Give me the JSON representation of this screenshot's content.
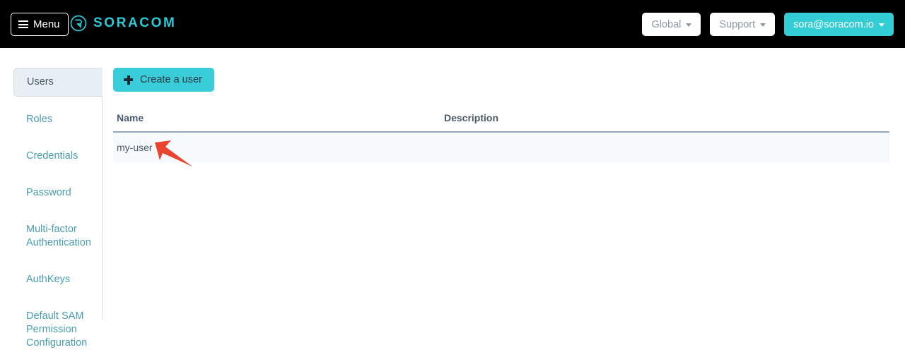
{
  "navbar": {
    "menu_label": "Menu",
    "menu_icon": "hamburger-icon",
    "brand_name": "SORACOM",
    "brand_icon": "soracom-logo-icon",
    "coverage_label": "Global",
    "support_label": "Support",
    "account_label": "sora@soracom.io",
    "caret_icon": "chevron-down-icon",
    "background_color": "#000000",
    "accent_color": "#33cdd6"
  },
  "sidebar": {
    "items": [
      {
        "label": "Users",
        "active": true
      },
      {
        "label": "Roles",
        "active": false
      },
      {
        "label": "Credentials",
        "active": false
      },
      {
        "label": "Password",
        "active": false
      },
      {
        "label": "Multi-factor Authentication",
        "active": false
      },
      {
        "label": "AuthKeys",
        "active": false
      },
      {
        "label": "Default SAM Permission Configuration",
        "active": false
      }
    ],
    "link_color": "#4a9cb0",
    "active_background": "#e7eff5"
  },
  "main": {
    "create_button_label": "Create a user",
    "create_button_icon": "plus-icon",
    "create_button_color": "#38cdd8",
    "table": {
      "columns": [
        "Name",
        "Description"
      ],
      "rows": [
        {
          "name": "my-user",
          "description": ""
        }
      ],
      "header_border_color": "#95a9bd",
      "row_background": "#f7fafd"
    }
  },
  "annotation": {
    "arrow_icon": "arrow-pointer-annotation",
    "color": "#e8442f",
    "points_to": "my-user"
  }
}
